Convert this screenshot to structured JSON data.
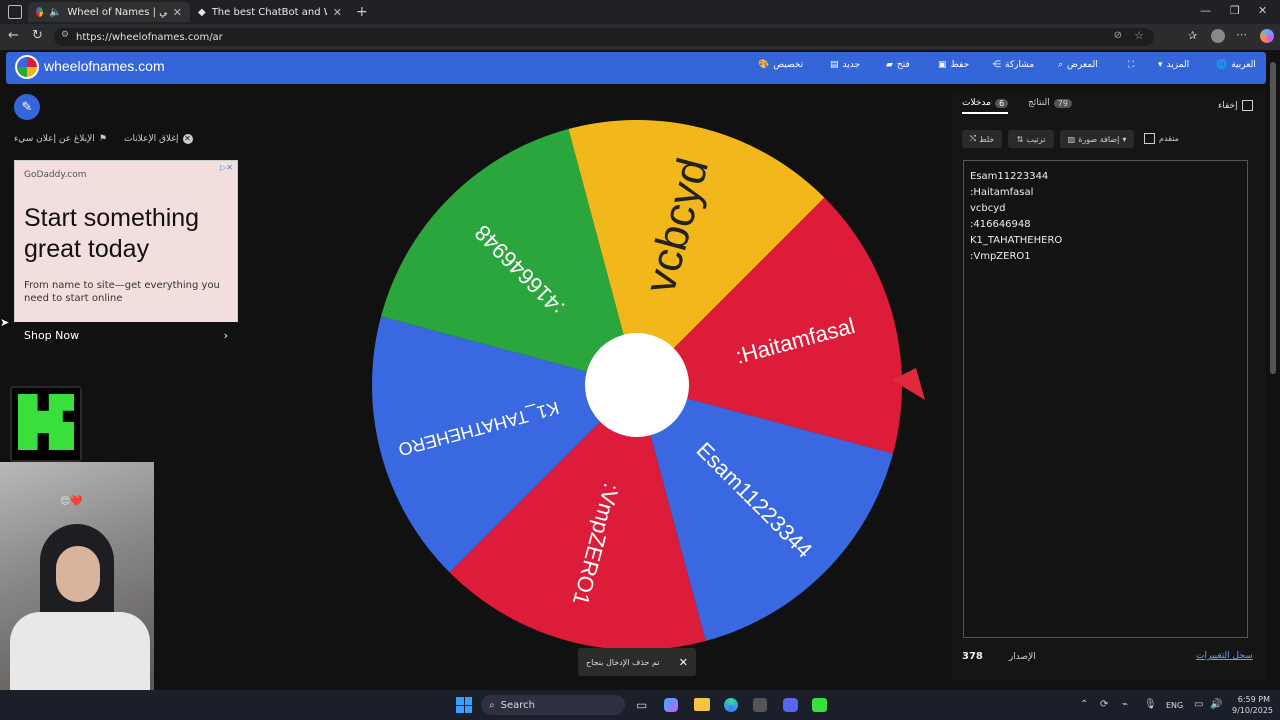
{
  "browser": {
    "tabs": [
      {
        "title": "Wheel of Names | العشوائي ...",
        "active": true
      },
      {
        "title": "The best ChatBot and Widgets fo...",
        "active": false
      }
    ],
    "url": "https://wheelofnames.com/ar"
  },
  "header": {
    "logo": "wheelofnames.com",
    "menu": {
      "customize": "تخصيص",
      "new": "جديد",
      "open": "فتح",
      "save": "حفظ",
      "share": "مشاركة",
      "gallery": "المعرض",
      "more": "المزيد",
      "language": "العربية"
    }
  },
  "left": {
    "report_ad": "الإبلاغ عن إعلان سيء",
    "close_ads": "إغلاق الإعلانات",
    "ad": {
      "domain": "GoDaddy.com",
      "headline": "Start something great today",
      "body": "From name to site—get everything you need to start online",
      "cta": "Shop Now"
    }
  },
  "wheel": {
    "segments": [
      {
        "label": "vcbcyd",
        "color": "#f2b81b"
      },
      {
        "label": ":Haitamfasal",
        "color": "#dd1c3a"
      },
      {
        "label": "Esam11223344",
        "color": "#3a68e0"
      },
      {
        "label": ":VmpZERO1",
        "color": "#dd1c3a"
      },
      {
        "label": "K1_TAHATHEHERO",
        "color": "#3a68e0"
      },
      {
        "label": ":416646948",
        "color": "#2aa63c"
      }
    ],
    "pointer_color": "#e0293b"
  },
  "panel": {
    "hide": "إخفاء",
    "tab_entries": "مدخلات",
    "entries_count": "6",
    "tab_results": "النتائج",
    "results_count": "79",
    "shuffle": "خلط",
    "sort": "ترتيب",
    "add_image": "إضافة صورة",
    "advanced": "متقدم",
    "entries": [
      "Esam11223344",
      ":Haitamfasal",
      "vcbcyd",
      ":416646948",
      "K1_TAHATHEHERO",
      ":VmpZERO1"
    ],
    "version_label": "الإصدار",
    "version": "378",
    "changelog": "سجل التغييرات"
  },
  "toast": {
    "message": "تم حذف الإدخال بنجاح"
  },
  "taskbar": {
    "search": "Search",
    "lang": "ENG",
    "time": "6:59 PM",
    "date": "9/10/2025"
  }
}
